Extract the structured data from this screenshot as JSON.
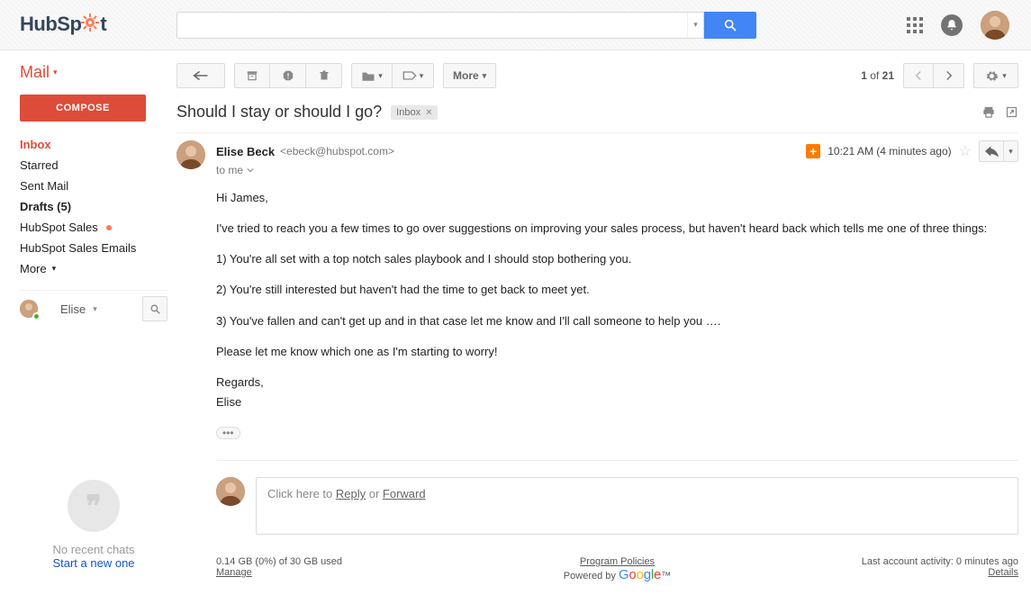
{
  "brand": {
    "label": "HubSpot"
  },
  "search": {
    "placeholder": ""
  },
  "sidebar": {
    "mail_label": "Mail",
    "compose": "COMPOSE",
    "items": [
      {
        "label": "Inbox"
      },
      {
        "label": "Starred"
      },
      {
        "label": "Sent Mail"
      },
      {
        "label": "Drafts (5)"
      },
      {
        "label": "HubSpot Sales"
      },
      {
        "label": "HubSpot Sales Emails"
      }
    ],
    "more": "More",
    "presence_name": "Elise",
    "hangouts": {
      "empty": "No recent chats",
      "start": "Start a new one"
    }
  },
  "toolbar": {
    "more": "More",
    "pager": {
      "current": "1",
      "of": "of",
      "total": "21"
    }
  },
  "thread": {
    "subject": "Should I stay or should I go?",
    "label_chip": "Inbox",
    "from": {
      "name": "Elise Beck",
      "email": "<ebeck@hubspot.com>"
    },
    "to": "to me",
    "timestamp": "10:21 AM (4 minutes ago)",
    "body": {
      "p1": "Hi James,",
      "p2": "I've tried to reach you a few times to go over suggestions on improving your sales process, but haven't heard back which tells me one of three things:",
      "p3": "1) You're all set with a top notch sales playbook and I should stop bothering you.",
      "p4": "2) You're still interested but haven't had the time to get back to meet yet.",
      "p5": "3) You've fallen and can't get up and in that case let me know and I'll call someone to help you ….",
      "p6": "Please let me know which one as I'm starting to worry!",
      "p7": "Regards,",
      "p8": "Elise"
    }
  },
  "reply": {
    "prefix": "Click here to ",
    "reply": "Reply",
    "or": " or ",
    "forward": "Forward"
  },
  "footer": {
    "storage": "0.14 GB (0%) of 30 GB used",
    "manage": "Manage",
    "policies": "Program Policies",
    "powered": "Powered by ",
    "activity": "Last account activity: 0 minutes ago",
    "details": "Details"
  }
}
